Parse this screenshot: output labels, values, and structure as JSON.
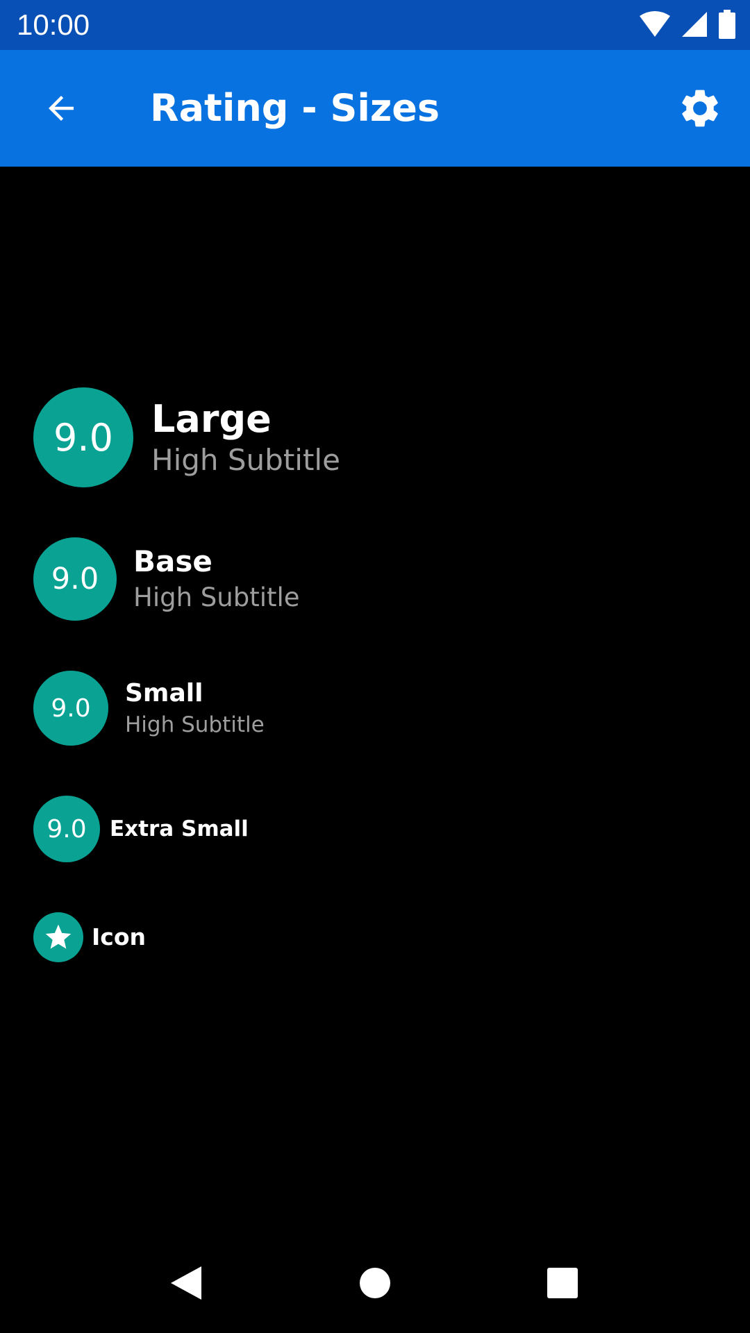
{
  "status_bar": {
    "time": "10:00",
    "icons": [
      "wifi-icon",
      "cellular-signal-icon",
      "battery-icon"
    ]
  },
  "app_bar": {
    "title": "Rating - Sizes",
    "back_icon": "arrow-back-icon",
    "settings_icon": "gear-icon",
    "background_color": "#0872e0"
  },
  "ratings": {
    "accent_color": "#09a293",
    "large": {
      "value": "9.0",
      "title": "Large",
      "subtitle": "High Subtitle"
    },
    "base": {
      "value": "9.0",
      "title": "Base",
      "subtitle": "High Subtitle"
    },
    "small": {
      "value": "9.0",
      "title": "Small",
      "subtitle": "High Subtitle"
    },
    "extra_small": {
      "value": "9.0",
      "title": "Extra Small"
    },
    "icon": {
      "icon": "star-icon",
      "title": "Icon"
    }
  },
  "nav_bar": {
    "items": [
      "nav-back-icon",
      "nav-home-icon",
      "nav-recents-icon"
    ]
  }
}
